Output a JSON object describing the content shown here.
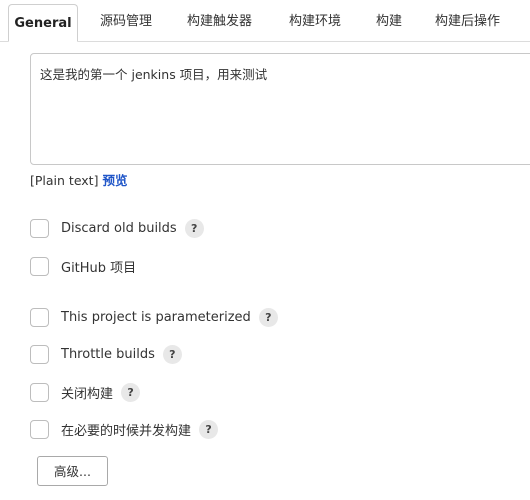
{
  "tabs": [
    {
      "label": "General",
      "active": true
    },
    {
      "label": "源码管理"
    },
    {
      "label": "构建触发器"
    },
    {
      "label": "构建环境"
    },
    {
      "label": "构建"
    },
    {
      "label": "构建后操作"
    }
  ],
  "description": {
    "value": "这是我的第一个 jenkins 项目，用来测试",
    "format_text": "[Plain text]",
    "preview_label": "预览"
  },
  "options": [
    {
      "label": "Discard old builds",
      "checked": false,
      "help": "?"
    },
    {
      "label": "GitHub 项目",
      "checked": false
    },
    {
      "label": "This project is parameterized",
      "checked": false,
      "help": "?"
    },
    {
      "label": "Throttle builds",
      "checked": false,
      "help": "?"
    },
    {
      "label": "关闭构建",
      "checked": false,
      "help": "?"
    },
    {
      "label": "在必要的时候并发构建",
      "checked": false,
      "help": "?"
    }
  ],
  "advanced_button": "高级..."
}
